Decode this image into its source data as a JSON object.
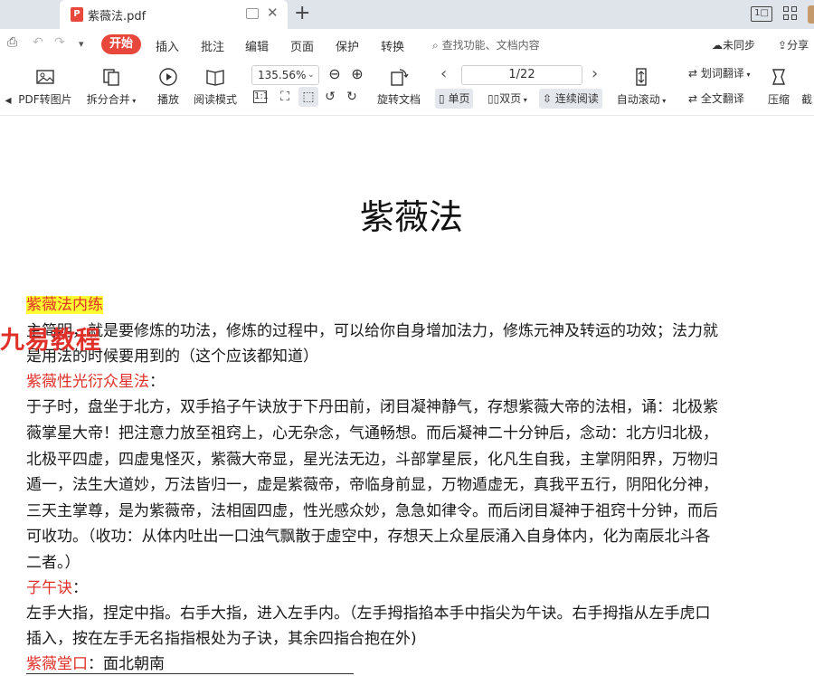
{
  "tab": {
    "title": "紫薇法.pdf",
    "pdf_icon": "P"
  },
  "window": {
    "layout_label": "1□"
  },
  "menu": {
    "start": "开始",
    "items": [
      "插入",
      "批注",
      "编辑",
      "页面",
      "保护",
      "转换"
    ],
    "search_placeholder": "查找功能、文档内容",
    "sync": "未同步",
    "share": "分享"
  },
  "toolbar": {
    "pdf_to_image": "PDF转图片",
    "split_merge": "拆分合并",
    "play": "播放",
    "read_mode": "阅读模式",
    "zoom": "135.56%",
    "rotate_doc": "旋转文档",
    "page_display": "1/22",
    "single_page": "单页",
    "double_page": "双页",
    "continuous": "连续阅读",
    "auto_scroll": "自动滚动",
    "word_translate": "划词翻译",
    "full_translate": "全文翻译",
    "compress": "压缩",
    "screenshot": "截"
  },
  "document": {
    "title": "紫薇法",
    "watermark": "九易教程",
    "sections": [
      {
        "kind": "highlight",
        "text": "紫薇法内练"
      },
      {
        "kind": "body",
        "text": "主简明，就是要修炼的功法，修炼的过程中，可以给你自身增加法力，修炼元神及转运的功效；法力就"
      },
      {
        "kind": "body",
        "text": "是用法的时候要用到的（这个应该都知道）"
      },
      {
        "kind": "heading",
        "text": "紫薇性光衍众星法",
        "suffix": "："
      },
      {
        "kind": "body",
        "text": "于子时，盘坐于北方，双手掐子午诀放于下丹田前，闭目凝神静气，存想紫薇大帝的法相，诵：北极紫"
      },
      {
        "kind": "body",
        "text": "薇掌星大帝！把注意力放至祖窍上，心无杂念，气通畅想。而后凝神二十分钟后，念动：北方归北极，"
      },
      {
        "kind": "body",
        "text": "北极平四虚，四虚鬼怪灭，紫薇大帝显，星光法无边，斗部掌星辰，化凡生自我，主掌阴阳界，万物归"
      },
      {
        "kind": "body",
        "text": "遁一，法生大道妙，万法皆归一，虚是紫薇帝，帝临身前显，万物遁虚无，真我平五行，阴阳化分神，"
      },
      {
        "kind": "body",
        "text": "三天主掌尊，是为紫薇帝，法相固四虚，性光感众妙，急急如律令。而后闭目凝神于祖窍十分钟，而后"
      },
      {
        "kind": "body",
        "text": "可收功。（收功：从体内吐出一口浊气飘散于虚空中，存想天上众星辰涌入自身体内，化为南辰北斗各"
      },
      {
        "kind": "body",
        "text": "二者。）"
      },
      {
        "kind": "heading",
        "text": "子午诀",
        "suffix": "："
      },
      {
        "kind": "body",
        "text": "左手大指，捏定中指。右手大指，进入左手内。（左手拇指掐本手中指尖为午诀。右手拇指从左手虎口"
      },
      {
        "kind": "body",
        "text": "插入，按在左手无名指指根处为子诀，其余四指合抱在外)"
      },
      {
        "kind": "heading",
        "text": "紫薇堂口",
        "suffix": "：面北朝南"
      }
    ]
  }
}
